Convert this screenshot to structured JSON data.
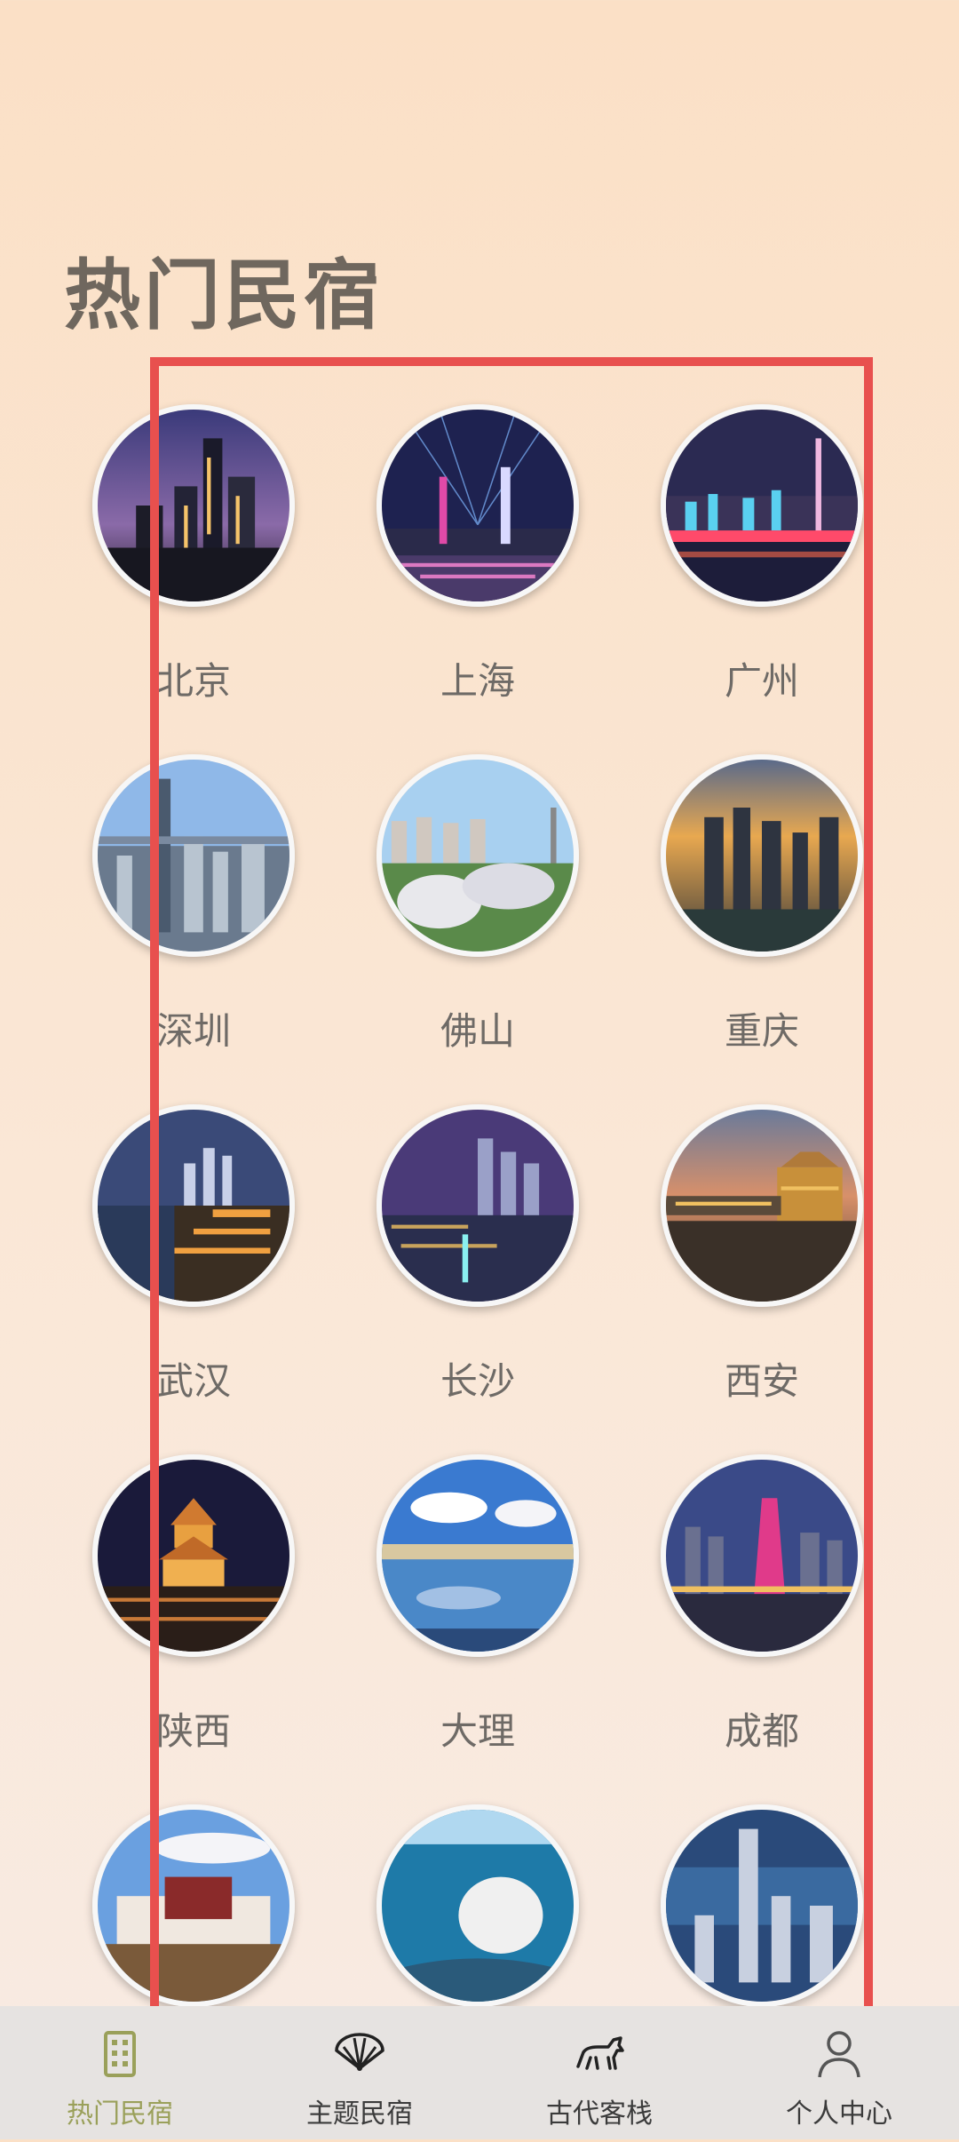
{
  "page_title": "热门民宿",
  "cities": [
    {
      "name": "北京",
      "image": "beijing-night-skyline"
    },
    {
      "name": "上海",
      "image": "shanghai-light-show"
    },
    {
      "name": "广州",
      "image": "guangzhou-tower-river"
    },
    {
      "name": "深圳",
      "image": "shenzhen-skyline-day"
    },
    {
      "name": "佛山",
      "image": "foshan-domes"
    },
    {
      "name": "重庆",
      "image": "chongqing-dusk"
    },
    {
      "name": "武汉",
      "image": "wuhan-night"
    },
    {
      "name": "长沙",
      "image": "changsha-night-aerial"
    },
    {
      "name": "西安",
      "image": "xian-dusk-wall"
    },
    {
      "name": "陕西",
      "image": "shaanxi-bell-tower"
    },
    {
      "name": "大理",
      "image": "dali-lake-clouds"
    },
    {
      "name": "成都",
      "image": "chengdu-tower-night"
    },
    {
      "name": "",
      "image": "potala-palace"
    },
    {
      "name": "",
      "image": "coastal-harbor"
    },
    {
      "name": "",
      "image": "hongkong-skyline"
    }
  ],
  "bottom_nav": {
    "items": [
      {
        "label": "热门民宿",
        "icon": "building-icon",
        "active": true
      },
      {
        "label": "主题民宿",
        "icon": "fan-icon",
        "active": false
      },
      {
        "label": "古代客栈",
        "icon": "horse-icon",
        "active": false
      },
      {
        "label": "个人中心",
        "icon": "person-icon",
        "active": false
      }
    ]
  },
  "colors": {
    "highlight_border": "#e8504e",
    "active_nav": "#9aa05a",
    "title_text": "#6f675e"
  }
}
